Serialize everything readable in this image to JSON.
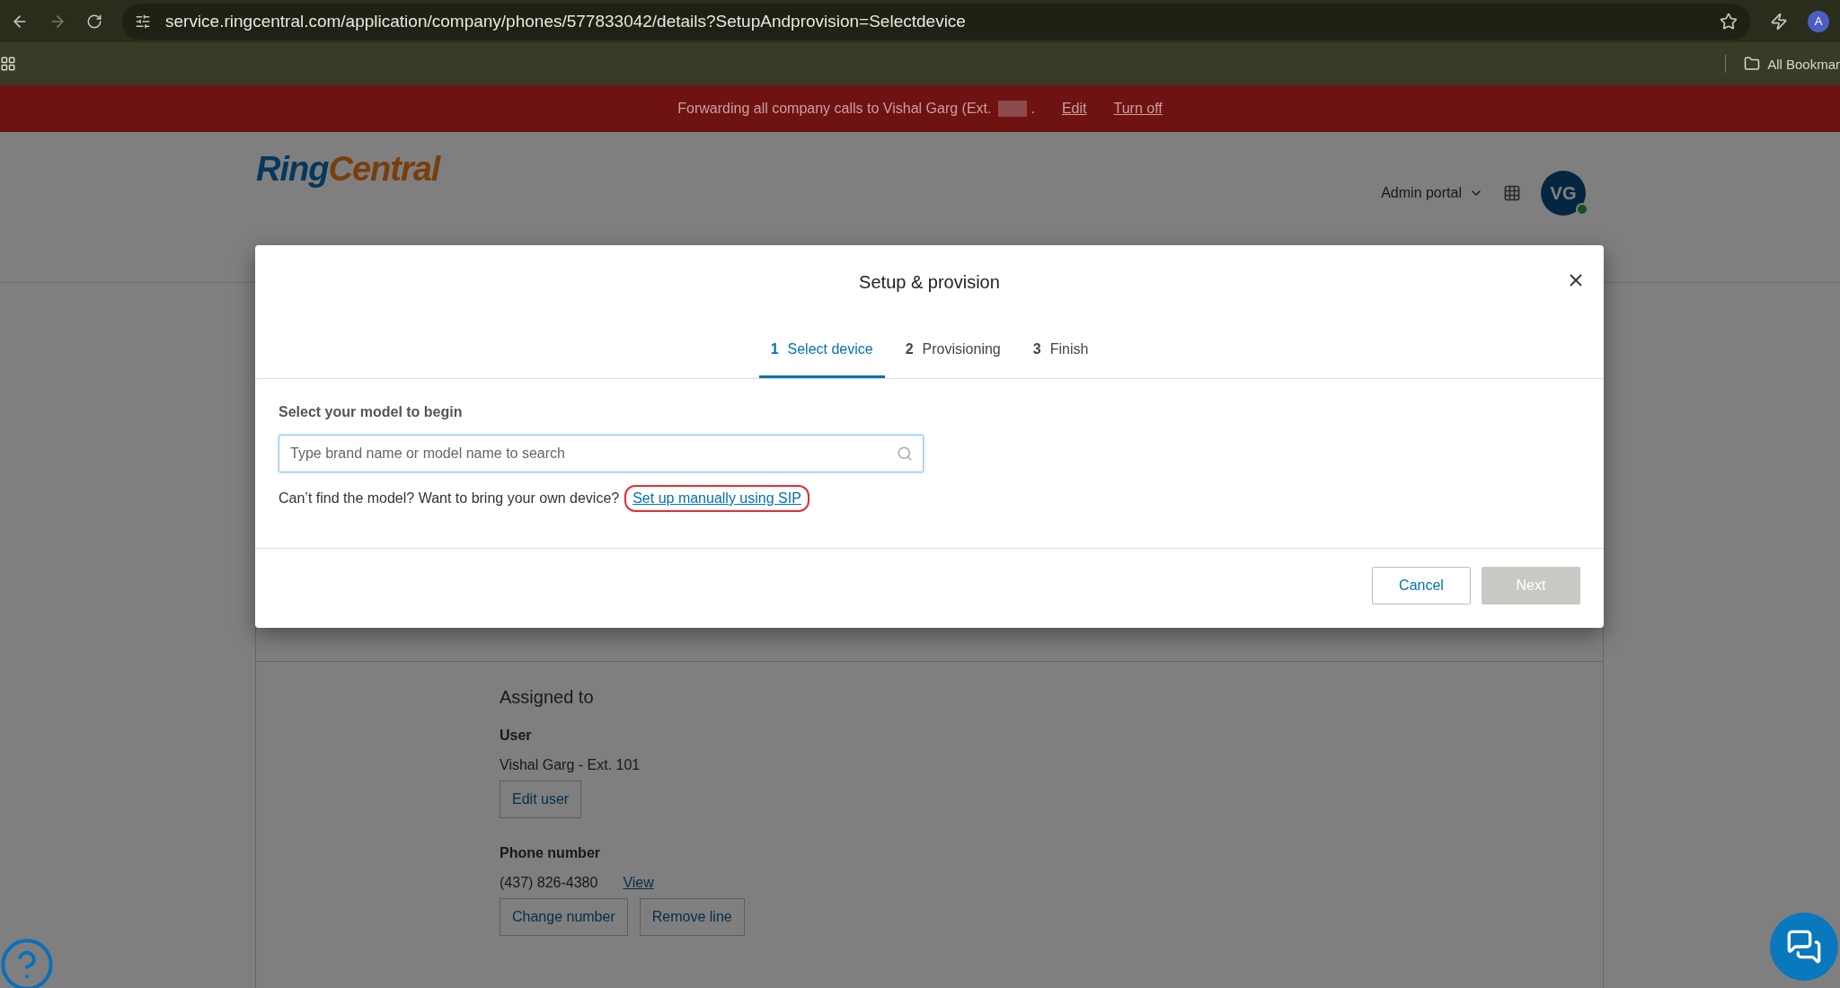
{
  "browser": {
    "url": "service.ringcentral.com/application/company/phones/577833042/details?SetupAndprovision=Selectdevice",
    "profile_initial": "A",
    "bookmarks_label": "All Bookmar"
  },
  "banner": {
    "text": "Forwarding all company calls to Vishal Garg (Ext.",
    "suffix": ".",
    "links": [
      "Edit",
      "Turn off"
    ]
  },
  "header": {
    "logo": [
      "Ring",
      "Central"
    ],
    "portal_menu": "Admin portal",
    "avatar_initials": "VG",
    "avatar_online": true
  },
  "details": {
    "section_title": "Assigned to",
    "user_label": "User",
    "user_value": "Vishal Garg - Ext. 101",
    "edit_user": "Edit user",
    "phone_label": "Phone number",
    "phone_value": "(437) 826-4380",
    "view_link": "View",
    "phone_buttons": [
      "Change number",
      "Remove line"
    ]
  },
  "dialog": {
    "title": "Setup & provision",
    "steps": [
      {
        "number": "1",
        "label": "Select device",
        "selected": true
      },
      {
        "number": "2",
        "label": "Provisioning",
        "selected": false
      },
      {
        "number": "3",
        "label": "Finish",
        "selected": false
      }
    ],
    "field_label": "Select your model to begin",
    "search": {
      "placeholder": "Type brand name or model name to search"
    },
    "hint": "Can’t find the model? Want to bring your own device?",
    "hint_link": "Set up manually using SIP",
    "hint_link_circled": true,
    "buttons": [
      {
        "label": "Cancel",
        "kind": "secondary",
        "disabled": false
      },
      {
        "label": "Next",
        "kind": "primary",
        "disabled": true
      }
    ]
  }
}
